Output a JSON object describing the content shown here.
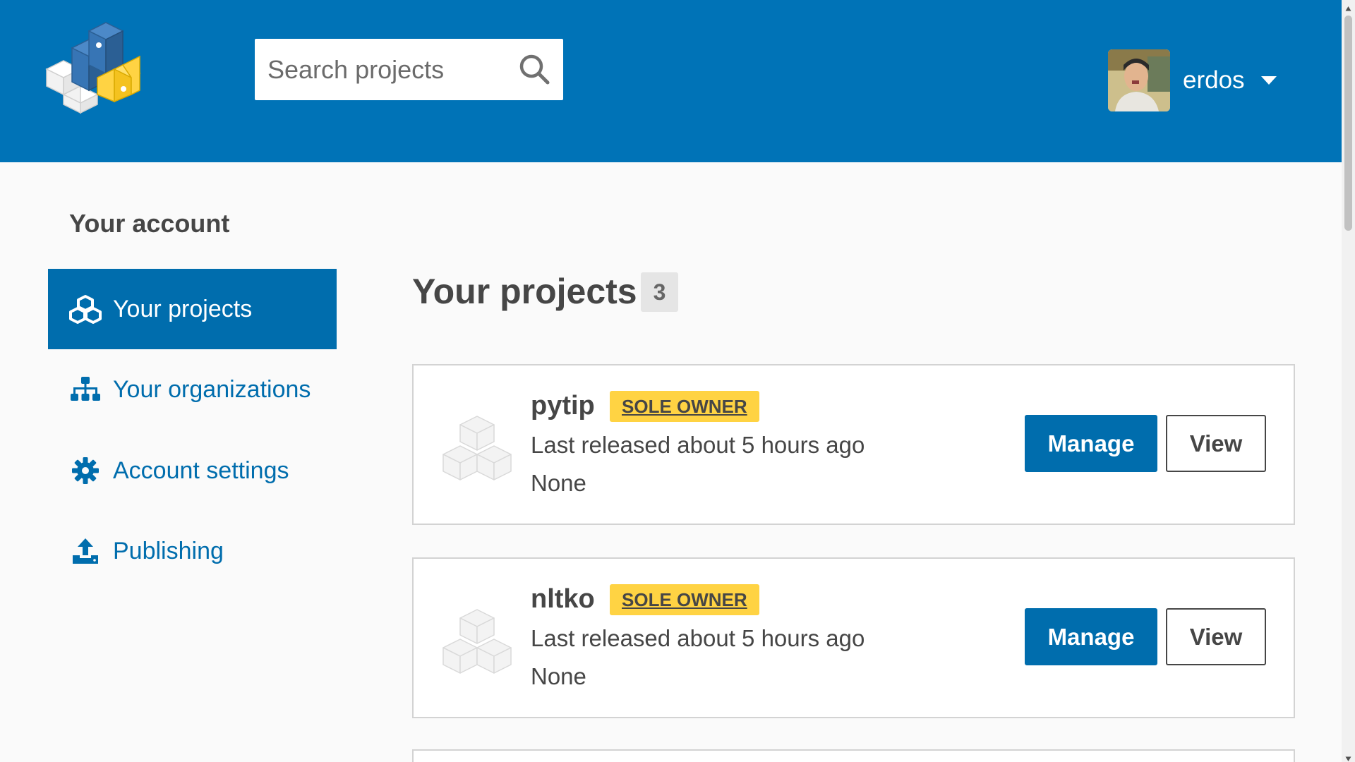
{
  "header": {
    "logo_icon": "pypi-cubes-logo-icon",
    "search": {
      "placeholder": "Search projects",
      "value": "",
      "icon": "search-icon"
    },
    "user": {
      "name": "erdos",
      "avatar": "user-avatar-photo",
      "menu_icon": "caret-down-icon"
    }
  },
  "sidebar": {
    "title": "Your account",
    "items": [
      {
        "label": "Your projects",
        "icon": "cubes-icon",
        "active": true
      },
      {
        "label": "Your organizations",
        "icon": "sitemap-icon",
        "active": false
      },
      {
        "label": "Account settings",
        "icon": "gear-icon",
        "active": false
      },
      {
        "label": "Publishing",
        "icon": "upload-icon",
        "active": false
      }
    ]
  },
  "main": {
    "title": "Your projects",
    "count": "3",
    "projects": [
      {
        "name": "pytip",
        "badge": "SOLE OWNER",
        "released": "Last released about 5 hours ago",
        "summary": "None",
        "manage_label": "Manage",
        "view_label": "View"
      },
      {
        "name": "nltko",
        "badge": "SOLE OWNER",
        "released": "Last released about 5 hours ago",
        "summary": "None",
        "manage_label": "Manage",
        "view_label": "View"
      }
    ]
  },
  "colors": {
    "header_bg": "#0073b7",
    "primary": "#006dad",
    "badge_yellow": "#ffd343",
    "text": "#464646"
  }
}
